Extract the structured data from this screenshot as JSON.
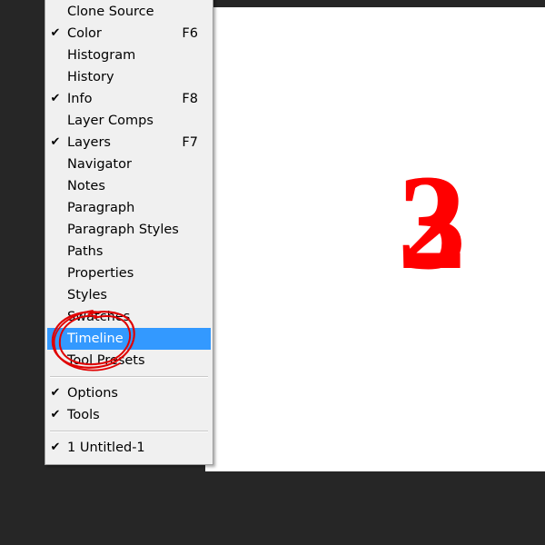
{
  "canvas": {
    "glyph_a": "3",
    "glyph_b": "2",
    "color": "#ff0000"
  },
  "menu": {
    "items": [
      {
        "label": "Clone Source",
        "checked": false,
        "shortcut": ""
      },
      {
        "label": "Color",
        "checked": true,
        "shortcut": "F6"
      },
      {
        "label": "Histogram",
        "checked": false,
        "shortcut": ""
      },
      {
        "label": "History",
        "checked": false,
        "shortcut": ""
      },
      {
        "label": "Info",
        "checked": true,
        "shortcut": "F8"
      },
      {
        "label": "Layer Comps",
        "checked": false,
        "shortcut": ""
      },
      {
        "label": "Layers",
        "checked": true,
        "shortcut": "F7"
      },
      {
        "label": "Navigator",
        "checked": false,
        "shortcut": ""
      },
      {
        "label": "Notes",
        "checked": false,
        "shortcut": ""
      },
      {
        "label": "Paragraph",
        "checked": false,
        "shortcut": ""
      },
      {
        "label": "Paragraph Styles",
        "checked": false,
        "shortcut": ""
      },
      {
        "label": "Paths",
        "checked": false,
        "shortcut": ""
      },
      {
        "label": "Properties",
        "checked": false,
        "shortcut": ""
      },
      {
        "label": "Styles",
        "checked": false,
        "shortcut": ""
      },
      {
        "label": "Swatches",
        "checked": false,
        "shortcut": ""
      },
      {
        "label": "Timeline",
        "checked": false,
        "shortcut": "",
        "highlighted": true
      },
      {
        "label": "Tool Presets",
        "checked": false,
        "shortcut": ""
      }
    ],
    "options": [
      {
        "label": "Options",
        "checked": true
      },
      {
        "label": "Tools",
        "checked": true
      }
    ],
    "documents": [
      {
        "label": "1 Untitled-1",
        "checked": true
      }
    ],
    "check_glyph": "✔",
    "highlight_color": "#3399ff"
  },
  "annotation": {
    "shape": "hand-drawn-circle",
    "target": "Timeline",
    "color": "#e00000"
  }
}
